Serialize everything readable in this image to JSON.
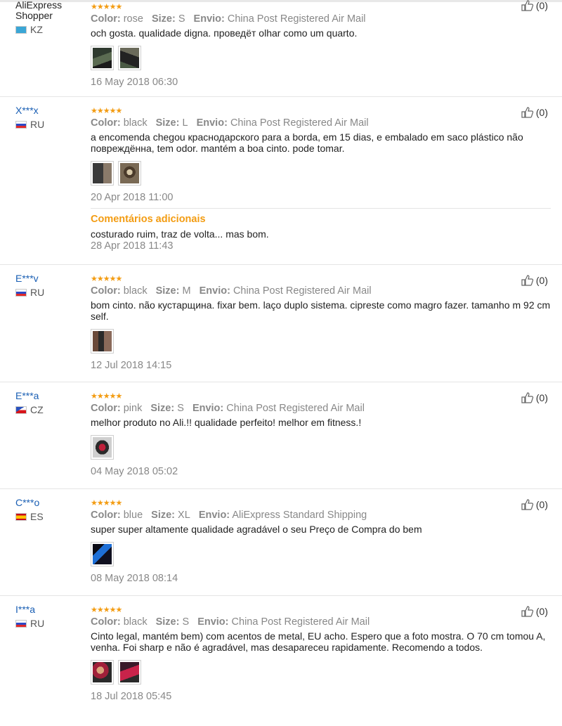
{
  "labels": {
    "color": "Color:",
    "size": "Size:",
    "shipping": "Envio:",
    "additional_title": "Comentários adicionais"
  },
  "stars": "★★★★★",
  "reviews": [
    {
      "user": "AliExpress Shopper",
      "country": "KZ",
      "color": "rose",
      "size": "S",
      "shipping": "China Post Registered Air Mail",
      "text": "och gosta. qualidade digna. проведёт olhar como um quarto.",
      "date": "16 May 2018 06:30",
      "helpful": "(0)"
    },
    {
      "user": "X***x",
      "country": "RU",
      "color": "black",
      "size": "L",
      "shipping": "China Post Registered Air Mail",
      "text": "a encomenda chegou краснодарского para a borda, em 15 dias, e embalado em saco plástico não повреждённа, tem odor. mantém a boa cinto. pode tomar.",
      "date": "20 Apr 2018 11:00",
      "helpful": "(0)",
      "additional_text": "costurado ruim, traz de volta... mas bom.",
      "additional_date": "28 Apr 2018 11:43"
    },
    {
      "user": "E***v",
      "country": "RU",
      "color": "black",
      "size": "M",
      "shipping": "China Post Registered Air Mail",
      "text": "bom cinto. não кустарщина. fixar bem. laço duplo sistema. cipreste como magro fazer. tamanho m 92 cm self.",
      "date": "12 Jul 2018 14:15",
      "helpful": "(0)"
    },
    {
      "user": "E***a",
      "country": "CZ",
      "color": "pink",
      "size": "S",
      "shipping": "China Post Registered Air Mail",
      "text": "melhor produto no Ali.!! qualidade perfeito! melhor em fitness.!",
      "date": "04 May 2018 05:02",
      "helpful": "(0)"
    },
    {
      "user": "C***o",
      "country": "ES",
      "color": "blue",
      "size": "XL",
      "shipping": "AliExpress Standard Shipping",
      "text": "super super altamente qualidade agradável o seu Preço de Compra do bem",
      "date": "08 May 2018 08:14",
      "helpful": "(0)"
    },
    {
      "user": "I***a",
      "country": "RU",
      "color": "black",
      "size": "S",
      "shipping": "China Post Registered Air Mail",
      "text": "Cinto legal, mantém bem) com acentos de metal, EU acho. Espero que a foto mostra. O 70 cm tomou A, venha. Foi sharp e não é agradável, mas desapareceu rapidamente. Recomendo a todos.",
      "date": "18 Jul 2018 05:45",
      "helpful": "(0)"
    }
  ]
}
